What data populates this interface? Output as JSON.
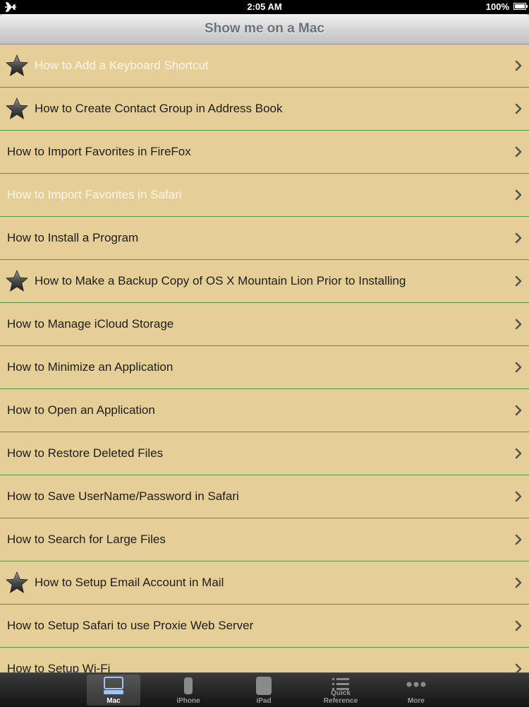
{
  "status_bar": {
    "time": "2:05 AM",
    "battery": "100%"
  },
  "nav_bar": {
    "title": "Show me on a Mac"
  },
  "list": {
    "items": [
      {
        "label": "How to Add a Keyboard Shortcut",
        "starred": true,
        "highlighted": true
      },
      {
        "label": "How to Create Contact Group in Address Book",
        "starred": true,
        "highlighted": false
      },
      {
        "label": "How to Import Favorites in FireFox",
        "starred": false,
        "highlighted": false
      },
      {
        "label": "How to Import Favorites in Safari",
        "starred": false,
        "highlighted": true
      },
      {
        "label": "How to Install a Program",
        "starred": false,
        "highlighted": false
      },
      {
        "label": "How to Make a Backup Copy of OS X Mountain Lion Prior to Installing",
        "starred": true,
        "highlighted": false
      },
      {
        "label": "How to Manage iCloud Storage",
        "starred": false,
        "highlighted": false
      },
      {
        "label": "How to Minimize an Application",
        "starred": false,
        "highlighted": false
      },
      {
        "label": "How to Open an Application",
        "starred": false,
        "highlighted": false
      },
      {
        "label": "How to Restore Deleted Files",
        "starred": false,
        "highlighted": false
      },
      {
        "label": "How to Save UserName/Password in Safari",
        "starred": false,
        "highlighted": false
      },
      {
        "label": "How to Search for Large Files",
        "starred": false,
        "highlighted": false
      },
      {
        "label": "How to Setup Email Account in Mail",
        "starred": true,
        "highlighted": false
      },
      {
        "label": "How to Setup Safari to use Proxie Web Server",
        "starred": false,
        "highlighted": false
      },
      {
        "label": "How to Setup Wi-Fi",
        "starred": false,
        "highlighted": false
      }
    ]
  },
  "tab_bar": {
    "tabs": [
      {
        "label": "Mac",
        "icon": "mac-icon",
        "active": true
      },
      {
        "label": "iPhone",
        "icon": "iphone-icon",
        "active": false
      },
      {
        "label": "iPad",
        "icon": "ipad-icon",
        "active": false
      },
      {
        "label": "Quick Reference",
        "icon": "quick-reference-icon",
        "active": false
      },
      {
        "label": "More",
        "icon": "more-icon",
        "active": false
      }
    ]
  },
  "colors": {
    "row_background": "#e6cf96",
    "separator": "#4e9b3a",
    "highlight_text": "#fbf6ea"
  }
}
